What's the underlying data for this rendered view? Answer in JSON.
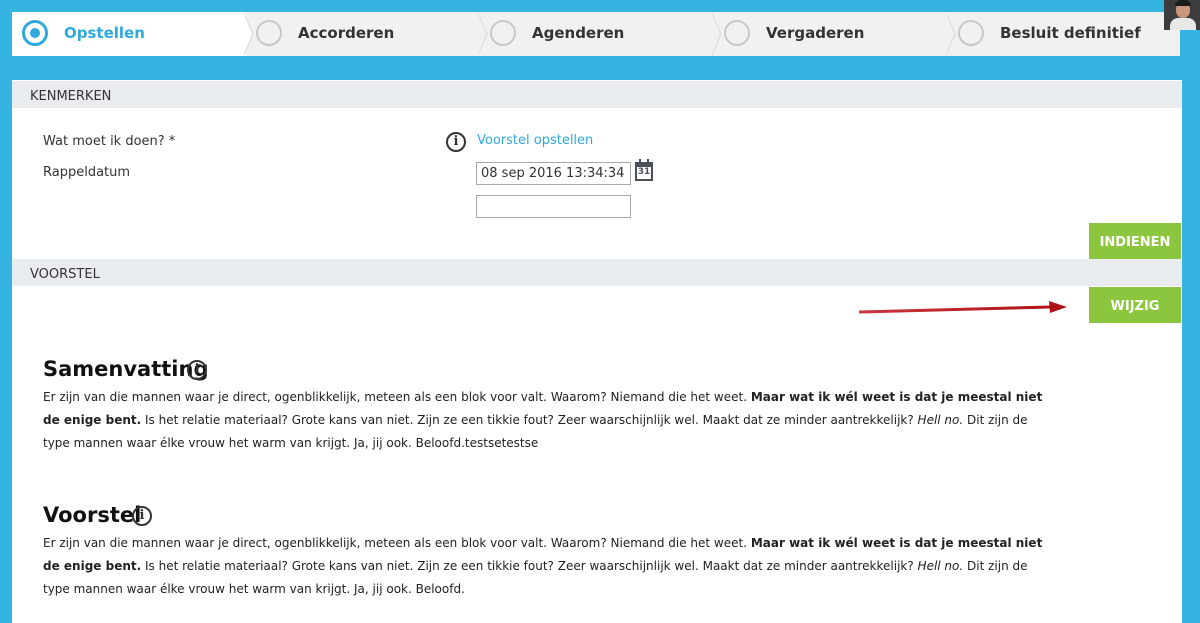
{
  "steps": [
    {
      "label": "Opstellen",
      "active": true
    },
    {
      "label": "Accorderen",
      "active": false
    },
    {
      "label": "Agenderen",
      "active": false
    },
    {
      "label": "Vergaderen",
      "active": false
    },
    {
      "label": "Besluit definitief",
      "active": false
    }
  ],
  "kenmerken": {
    "heading": "KENMERKEN",
    "task_label": "Wat moet ik doen? *",
    "task_link": "Voorstel opstellen",
    "reminder_label": "Rappeldatum",
    "reminder_value": "08 sep 2016 13:34:34",
    "reminder_extra_value": "",
    "calendar_day": "31",
    "submit_button": "INDIENEN"
  },
  "voorstel_section": {
    "heading": "VOORSTEL",
    "edit_button": "WIJZIG"
  },
  "samenvatting": {
    "title": "Samenvatting",
    "text_1": "Er zijn van die mannen waar je direct, ogenblikkelijk, meteen als een blok voor valt. Waarom? Niemand die het weet. ",
    "text_bold": "Maar wat ik wél weet is dat je meestal niet de enige bent.",
    "text_2": " Is het relatie materiaal? Grote kans van niet. Zijn ze een tikkie fout? Zeer waarschijnlijk wel. Maakt dat ze minder aantrekkelijk? ",
    "text_italic": "Hell no.",
    "text_3": " Dit zijn de type mannen waar élke vrouw het warm van krijgt. Ja, jij ook. Beloofd.testsetestse"
  },
  "voorstel": {
    "title": "Voorstel",
    "text_1": "Er zijn van die mannen waar je direct, ogenblikkelijk, meteen als een blok voor valt. Waarom? Niemand die het weet. ",
    "text_bold": "Maar wat ik wél weet is dat je meestal niet de enige bent.",
    "text_2": " Is het relatie materiaal? Grote kans van niet. Zijn ze een tikkie fout? Zeer waarschijnlijk wel. Maakt dat ze minder aantrekkelijk? ",
    "text_italic": "Hell no.",
    "text_3": " Dit zijn de type mannen waar élke vrouw het warm van krijgt. Ja, jij ook. Beloofd."
  },
  "colors": {
    "background": "#35b4e2",
    "accent": "#2fa8dc",
    "button_green": "#8cc63f",
    "arrow": "#c0141b"
  },
  "icons": {
    "info": "info-circle-icon",
    "calendar": "calendar-icon"
  }
}
